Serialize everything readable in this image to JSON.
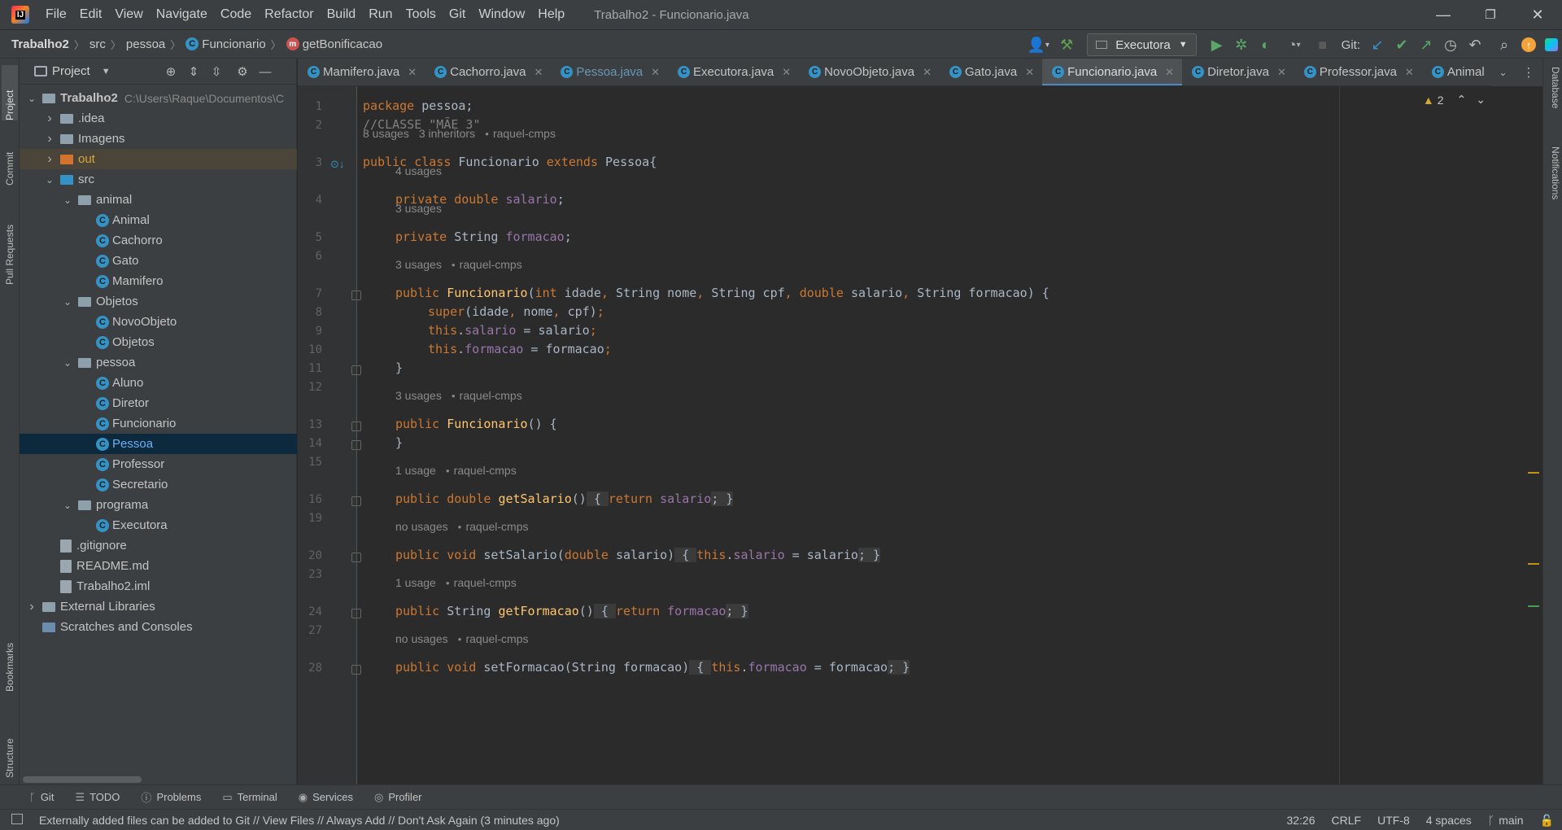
{
  "menu": {
    "items": [
      "File",
      "Edit",
      "View",
      "Navigate",
      "Code",
      "Refactor",
      "Build",
      "Run",
      "Tools",
      "Git",
      "Window",
      "Help"
    ],
    "window_title": "Trabalho2 - Funcionario.java"
  },
  "window_controls": {
    "minimize": "—",
    "restore": "❐",
    "close": "✕"
  },
  "breadcrumb": {
    "project": "Trabalho2",
    "src": "src",
    "package": "pessoa",
    "class": "Funcionario",
    "method": "getBonificacao"
  },
  "toolbar": {
    "run_config": "Executora",
    "git_label": "Git:"
  },
  "left_stripe": {
    "project": "Project",
    "commit": "Commit",
    "pull_requests": "Pull Requests",
    "bookmarks": "Bookmarks",
    "structure": "Structure"
  },
  "right_stripe": {
    "database": "Database",
    "notifications": "Notifications"
  },
  "project_panel": {
    "title": "Project",
    "tree": [
      {
        "label": "Trabalho2",
        "hint": "C:\\Users\\Raque\\Documentos\\C",
        "kind": "project",
        "depth": 0,
        "arrow": "open"
      },
      {
        "label": ".idea",
        "kind": "folder",
        "depth": 1,
        "arrow": "closed"
      },
      {
        "label": "Imagens",
        "kind": "folder",
        "depth": 1,
        "arrow": "closed"
      },
      {
        "label": "out",
        "kind": "out",
        "depth": 1,
        "arrow": "closed"
      },
      {
        "label": "src",
        "kind": "src",
        "depth": 1,
        "arrow": "open"
      },
      {
        "label": "animal",
        "kind": "pkg",
        "depth": 2,
        "arrow": "open"
      },
      {
        "label": "Animal",
        "kind": "class",
        "depth": 3
      },
      {
        "label": "Cachorro",
        "kind": "class",
        "depth": 3
      },
      {
        "label": "Gato",
        "kind": "class",
        "depth": 3
      },
      {
        "label": "Mamifero",
        "kind": "class",
        "depth": 3
      },
      {
        "label": "Objetos",
        "kind": "pkg",
        "depth": 2,
        "arrow": "open"
      },
      {
        "label": "NovoObjeto",
        "kind": "class",
        "depth": 3
      },
      {
        "label": "Objetos",
        "kind": "class",
        "depth": 3
      },
      {
        "label": "pessoa",
        "kind": "pkg",
        "depth": 2,
        "arrow": "open"
      },
      {
        "label": "Aluno",
        "kind": "class",
        "depth": 3
      },
      {
        "label": "Diretor",
        "kind": "class",
        "depth": 3
      },
      {
        "label": "Funcionario",
        "kind": "class",
        "depth": 3
      },
      {
        "label": "Pessoa",
        "kind": "class",
        "depth": 3,
        "selected": true
      },
      {
        "label": "Professor",
        "kind": "class",
        "depth": 3
      },
      {
        "label": "Secretario",
        "kind": "class",
        "depth": 3
      },
      {
        "label": "programa",
        "kind": "pkg",
        "depth": 2,
        "arrow": "open"
      },
      {
        "label": "Executora",
        "kind": "class",
        "depth": 3
      },
      {
        "label": ".gitignore",
        "kind": "file",
        "depth": 1
      },
      {
        "label": "README.md",
        "kind": "file",
        "depth": 1
      },
      {
        "label": "Trabalho2.iml",
        "kind": "file",
        "depth": 1
      },
      {
        "label": "External Libraries",
        "kind": "lib",
        "depth": 0,
        "arrow": "closed"
      },
      {
        "label": "Scratches and Consoles",
        "kind": "scratch",
        "depth": 0
      }
    ]
  },
  "tabs": [
    {
      "label": "Mamifero.java"
    },
    {
      "label": "Cachorro.java"
    },
    {
      "label": "Pessoa.java",
      "modified": true
    },
    {
      "label": "Executora.java"
    },
    {
      "label": "NovoObjeto.java"
    },
    {
      "label": "Gato.java"
    },
    {
      "label": "Funcionario.java",
      "active": true
    },
    {
      "label": "Diretor.java"
    },
    {
      "label": "Professor.java"
    },
    {
      "label": "Animal",
      "truncated": true
    }
  ],
  "editor": {
    "warnings": "2",
    "line_numbers": [
      "1",
      "2",
      "3",
      "4",
      "5",
      "6",
      "7",
      "8",
      "9",
      "10",
      "11",
      "12",
      "13",
      "14",
      "15",
      "16",
      "19",
      "20",
      "23",
      "24",
      "27",
      "28"
    ],
    "hints": {
      "class": [
        "8 usages",
        "3 inheritors",
        "raquel-cmps"
      ],
      "salario": [
        "4 usages"
      ],
      "formacao": [
        "3 usages"
      ],
      "ctor1": [
        "3 usages",
        "raquel-cmps"
      ],
      "ctor2": [
        "3 usages",
        "raquel-cmps"
      ],
      "getSalario": [
        "1 usage",
        "raquel-cmps"
      ],
      "setSalario": [
        "no usages",
        "raquel-cmps"
      ],
      "getFormacao": [
        "1 usage",
        "raquel-cmps"
      ],
      "setFormacao": [
        "no usages",
        "raquel-cmps"
      ]
    },
    "code": {
      "l1": [
        "package",
        " pessoa;"
      ],
      "l2": "//CLASSE \"MÃE 3\"",
      "l3": [
        "public class ",
        "Funcionario ",
        "extends ",
        "Pessoa{"
      ],
      "l4": [
        "private double ",
        "salario",
        ";"
      ],
      "l5": [
        "private ",
        "String ",
        "formacao",
        ";"
      ],
      "l7": [
        "public ",
        "Funcionario",
        "(",
        "int ",
        "idade",
        ", ",
        "String nome",
        ", ",
        "String cpf",
        ", ",
        "double ",
        "salario",
        ", ",
        "String formacao",
        ") {"
      ],
      "l8": [
        "super",
        "(idade",
        ", ",
        "nome",
        ", ",
        "cpf)",
        ";"
      ],
      "l9": [
        "this",
        ".",
        "salario",
        " = salario",
        ";"
      ],
      "l10": [
        "this",
        ".",
        "formacao",
        " = formacao",
        ";"
      ],
      "l11": "}",
      "l13": [
        "public ",
        "Funcionario",
        "() {"
      ],
      "l14": "}",
      "l16": [
        "public double ",
        "getSalario",
        "()",
        " { ",
        "return ",
        "salario",
        "; ",
        "}"
      ],
      "l20": [
        "public void ",
        "setSalario",
        "(",
        "double ",
        "salario)",
        " { ",
        "this",
        ".",
        "salario",
        " = salario",
        "; ",
        "}"
      ],
      "l24": [
        "public ",
        "String ",
        "getFormacao",
        "()",
        " { ",
        "return ",
        "formacao",
        "; ",
        "}"
      ],
      "l28": [
        "public void ",
        "setFormacao",
        "(String formacao)",
        " { ",
        "this",
        ".",
        "formacao",
        " = formacao",
        "; ",
        "}"
      ]
    }
  },
  "bottom_tools": [
    {
      "label": "Git",
      "icon": "git-branch-icon"
    },
    {
      "label": "TODO",
      "icon": "list-icon"
    },
    {
      "label": "Problems",
      "icon": "info-icon"
    },
    {
      "label": "Terminal",
      "icon": "terminal-icon"
    },
    {
      "label": "Services",
      "icon": "services-icon"
    },
    {
      "label": "Profiler",
      "icon": "profiler-icon"
    }
  ],
  "status": {
    "message": "Externally added files can be added to Git // View Files // Always Add // Don't Ask Again (3 minutes ago)",
    "position": "32:26",
    "line_sep": "CRLF",
    "encoding": "UTF-8",
    "indent": "4 spaces",
    "branch": "main"
  },
  "colors": {
    "accent": "#4a88c7",
    "selection": "#0d293e",
    "keyword": "#cc7832",
    "method": "#ffc66d",
    "field": "#9876aa"
  }
}
